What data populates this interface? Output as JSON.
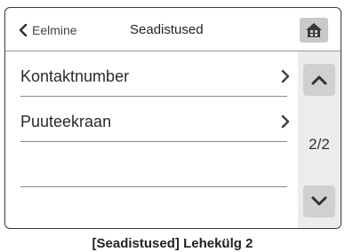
{
  "header": {
    "back_label": "Eelmine",
    "title": "Seadistused",
    "home_icon": "home-icon"
  },
  "menu": {
    "items": [
      {
        "label": "Kontaktnumber",
        "icon": "chevron-right-icon"
      },
      {
        "label": "Puuteekraan",
        "icon": "chevron-right-icon"
      }
    ]
  },
  "scroll": {
    "page_indicator": "2/2",
    "up_icon": "chevron-up-icon",
    "down_icon": "chevron-down-icon"
  },
  "caption": "[Seadistused] Lehekülg 2"
}
